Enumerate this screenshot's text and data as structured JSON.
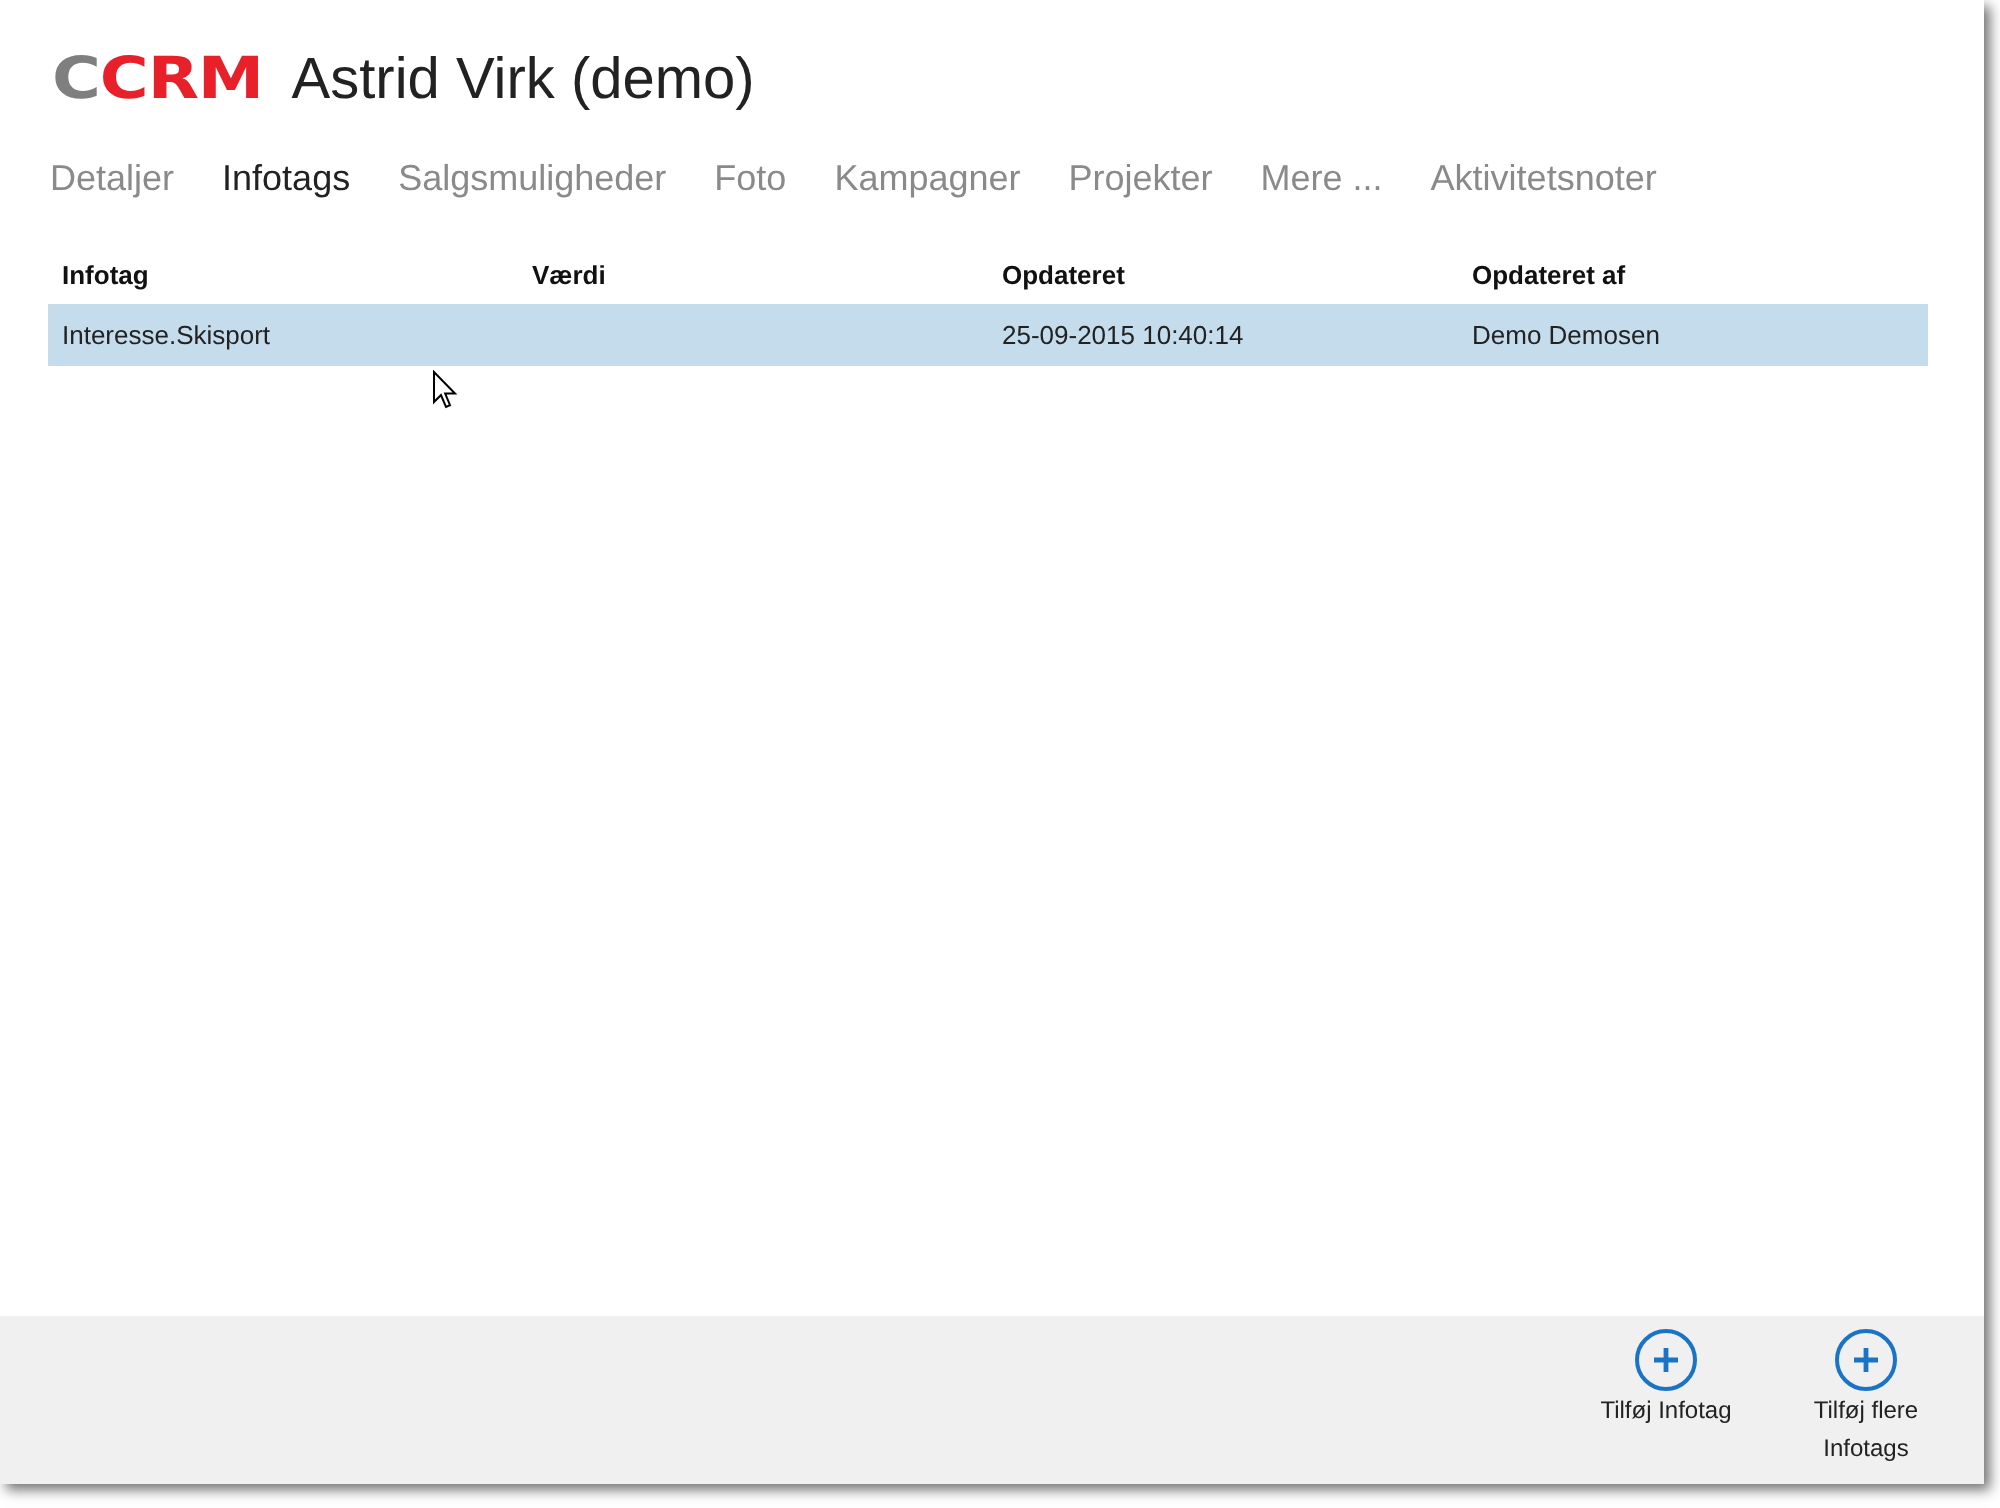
{
  "header": {
    "logo": [
      {
        "text": "C",
        "color": "#7f7f7f"
      },
      {
        "text": "CRM",
        "color": "#e8202a"
      }
    ],
    "title": "Astrid Virk (demo)"
  },
  "tabs": [
    {
      "label": "Detaljer",
      "selected": false
    },
    {
      "label": "Infotags",
      "selected": true
    },
    {
      "label": "Salgsmuligheder",
      "selected": false
    },
    {
      "label": "Foto",
      "selected": false
    },
    {
      "label": "Kampagner",
      "selected": false
    },
    {
      "label": "Projekter",
      "selected": false
    },
    {
      "label": "Mere ...",
      "selected": false
    },
    {
      "label": "Aktivitetsnoter",
      "selected": false
    }
  ],
  "table": {
    "columns": [
      "Infotag",
      "Værdi",
      "Opdateret",
      "Opdateret af"
    ],
    "rows": [
      {
        "cells": [
          "Interesse.Skisport",
          "",
          "25-09-2015 10:40:14",
          "Demo Demosen"
        ],
        "selected": true
      }
    ]
  },
  "actions": [
    {
      "label": "Tilføj Infotag"
    },
    {
      "label": "Tilføj flere Infotags"
    }
  ]
}
